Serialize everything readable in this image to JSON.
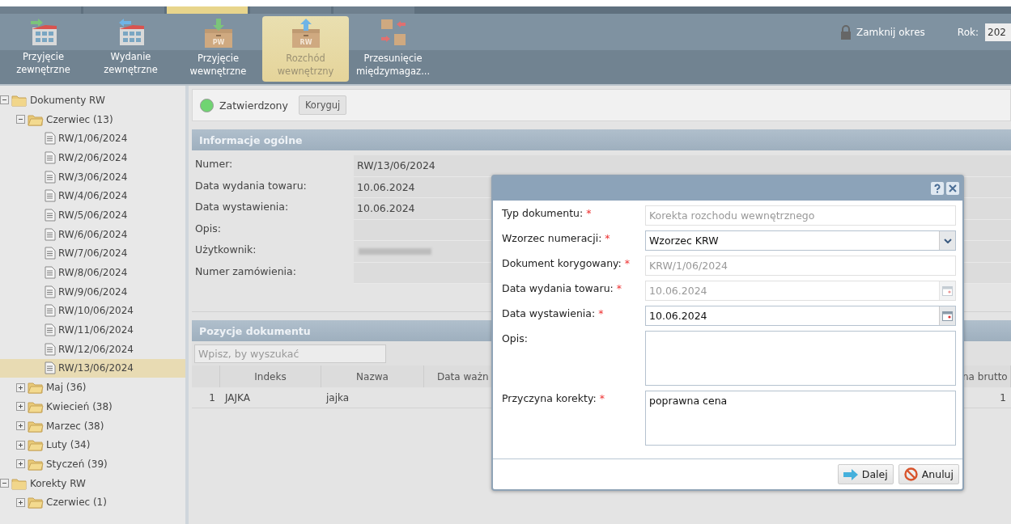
{
  "menu_tabs": [
    {
      "selected": false
    },
    {
      "selected": false
    },
    {
      "selected": true
    },
    {
      "selected": false
    },
    {
      "selected": false
    }
  ],
  "toolbar": {
    "buttons": [
      {
        "kind": "building-in",
        "label": "Przyjęcie\nzewnętrzne",
        "selected": false
      },
      {
        "kind": "building-out",
        "label": "Wydanie\nzewnętrzne",
        "selected": false
      },
      {
        "kind": "box-in",
        "badge": "PW",
        "label": "Przyjęcie\nwewnętrzne",
        "selected": false
      },
      {
        "kind": "box-out",
        "badge": "RW",
        "label": "Rozchód\nwewnętrzny",
        "selected": true
      },
      {
        "kind": "transfer",
        "label": "Przesunięcie\nmiędzymagaz...",
        "selected": false
      }
    ],
    "close_period": "Zamknij okres",
    "year_label": "Rok:",
    "year_value": "202"
  },
  "tree": [
    {
      "label": "Dokumenty RW",
      "expanded": true,
      "children": [
        {
          "label": "Czerwiec (13)",
          "expanded": true,
          "children": [
            {
              "label": "RW/1/06/2024",
              "selected": false
            },
            {
              "label": "RW/2/06/2024",
              "selected": false
            },
            {
              "label": "RW/3/06/2024",
              "selected": false
            },
            {
              "label": "RW/4/06/2024",
              "selected": false
            },
            {
              "label": "RW/5/06/2024",
              "selected": false
            },
            {
              "label": "RW/6/06/2024",
              "selected": false
            },
            {
              "label": "RW/7/06/2024",
              "selected": false
            },
            {
              "label": "RW/8/06/2024",
              "selected": false
            },
            {
              "label": "RW/9/06/2024",
              "selected": false
            },
            {
              "label": "RW/10/06/2024",
              "selected": false
            },
            {
              "label": "RW/11/06/2024",
              "selected": false
            },
            {
              "label": "RW/12/06/2024",
              "selected": false
            },
            {
              "label": "RW/13/06/2024",
              "selected": true
            }
          ]
        },
        {
          "label": "Maj (36)",
          "expanded": false
        },
        {
          "label": "Kwiecień (38)",
          "expanded": false
        },
        {
          "label": "Marzec (38)",
          "expanded": false
        },
        {
          "label": "Luty (34)",
          "expanded": false
        },
        {
          "label": "Styczeń (39)",
          "expanded": false
        }
      ]
    },
    {
      "label": "Korekty RW",
      "expanded": true,
      "children": [
        {
          "label": "Czerwiec (1)",
          "expanded": false
        }
      ]
    }
  ],
  "status": {
    "approved": true,
    "label": "Zatwierdzony",
    "button": "Koryguj"
  },
  "general": {
    "title": "Informacje ogólne",
    "fields": [
      {
        "label": "Numer:",
        "value": "RW/13/06/2024"
      },
      {
        "label": "Data wydania towaru:",
        "value": "10.06.2024"
      },
      {
        "label": "Data wystawienia:",
        "value": "10.06.2024"
      },
      {
        "label": "Opis:"
      },
      {
        "label": "Użytkownik:",
        "redacted": true
      },
      {
        "label": "Numer zamówienia:"
      }
    ]
  },
  "positions": {
    "title": "Pozycje dokumentu",
    "search_placeholder": "Wpisz, by wyszukać",
    "columns": [
      "Indeks",
      "Nazwa",
      "Data ważn",
      "na brutto"
    ],
    "rows": [
      {
        "number": "1",
        "indeks": "JAJKA",
        "nazwa": "jajka",
        "column_4": "1"
      }
    ]
  },
  "dialog": {
    "fields": [
      {
        "kind": "text",
        "label": "Typ dokumentu:",
        "required_mark": "*",
        "value": "Korekta rozchodu wewnętrznego",
        "disabled": true
      },
      {
        "kind": "select",
        "label": "Wzorzec numeracji:",
        "required_mark": "*",
        "value": "Wzorzec KRW",
        "disabled": false
      },
      {
        "kind": "text",
        "label": "Dokument korygowany:",
        "required_mark": "*",
        "value": "KRW/1/06/2024",
        "disabled": true
      },
      {
        "kind": "date",
        "label": "Data wydania towaru:",
        "required_mark": "*",
        "value": "10.06.2024",
        "disabled": true
      },
      {
        "kind": "date",
        "label": "Data wystawienia:",
        "required_mark": "*",
        "value": "10.06.2024",
        "disabled": false
      },
      {
        "kind": "textarea",
        "label": "Opis:",
        "disabled": false
      },
      {
        "kind": "textarea",
        "label": "Przyczyna korekty:",
        "required_mark": "*",
        "value": "poprawna cena",
        "disabled": false
      }
    ],
    "buttons": [
      {
        "kind": "next",
        "label": "Dalej"
      },
      {
        "kind": "cancel",
        "label": "Anuluj"
      }
    ]
  }
}
